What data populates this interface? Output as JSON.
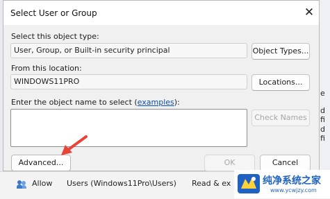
{
  "dialog": {
    "title": "Select User or Group",
    "object_type": {
      "label": "Select this object type:",
      "value": "User, Group, or Built-in security principal",
      "button": "Object Types..."
    },
    "location": {
      "label": "From this location:",
      "value": "WINDOWS11PRO",
      "button": "Locations..."
    },
    "object_name": {
      "label_prefix": "Enter the object name to select (",
      "label_link": "examples",
      "label_suffix": "):",
      "value": "",
      "check_button": "Check Names"
    },
    "advanced_button": "Advanced...",
    "ok_button": "OK",
    "cancel_button": "Cancel"
  },
  "background": {
    "row": {
      "permission": "Allow",
      "principal": "Users (Windows11Pro\\Users)",
      "access": "Read & ex"
    },
    "right_fragments": [
      "e",
      "d fi",
      "d fi"
    ]
  },
  "watermark": {
    "name": "纯净系统之家",
    "url": "www.ycwjzy.com"
  },
  "colors": {
    "accent_link": "#0a4fb4",
    "arrow": "#e8443a",
    "watermark": "#1f62c2"
  }
}
